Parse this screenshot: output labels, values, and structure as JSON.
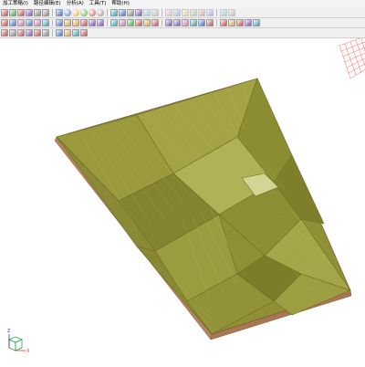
{
  "menubar": {
    "items": [
      {
        "label": "加工策略(I)"
      },
      {
        "label": "路径编辑(E)"
      },
      {
        "label": "分析(A)"
      },
      {
        "label": "工具(T)"
      },
      {
        "label": "帮助(H)"
      }
    ]
  },
  "toolbar_icons": {
    "row1": [
      "window-icon",
      "cube-icon",
      "open-icon",
      "save-icon",
      "print-icon",
      "undo-icon",
      "layer-icon",
      "shade-sphere-icon",
      "shade-sphere-icon",
      "shade-sphere-icon",
      "shade-sphere-icon",
      "sphere-outline-icon",
      "wire-icon",
      "render-icon",
      "zoom-window-icon",
      "zoom-fit-icon",
      "dim-tool-icon",
      "dim-tool-icon",
      "dim-tool-icon",
      "dim-tool-icon",
      "dim-tool-icon",
      "dim-tool-icon",
      "dim-tool-icon",
      "dim-tool-icon",
      "dim-tool-icon",
      "dim-tool-icon"
    ],
    "row2": [
      "select-icon",
      "view-front-icon",
      "view-iso-icon",
      "view-top-icon",
      "rotate-icon",
      "pan-icon",
      "arrow-icon",
      "close-icon",
      "grid-icon",
      "layer-icon",
      "curve-icon",
      "tool-icon",
      "path-icon",
      "check-icon",
      "measure-icon",
      "surface-icon",
      "snap-icon",
      "cross-icon",
      "arrow-icon",
      "page-icon",
      "wrench-icon",
      "pin-icon",
      "trace-icon",
      "palette-icon",
      "layers-icon",
      "sim-icon",
      "dots-icon",
      "gear-icon",
      "text-icon"
    ],
    "row3": [
      "select-icon",
      "view-iso-icon",
      "grid-icon",
      "dash-icon",
      "line-style-icon",
      "plus-icon",
      "cross-icon",
      "color-icon",
      "material-icon",
      "brush-icon"
    ]
  },
  "viewport": {
    "axis_labels": {
      "x": "X",
      "z": "Z"
    },
    "colors": {
      "surface": "#8f8f35",
      "surface_dark": "#6f6f27",
      "surface_light": "#b4b45a",
      "edge": "#a06a4a",
      "side": "#b5845f",
      "hint": "#ff4d4d"
    }
  }
}
